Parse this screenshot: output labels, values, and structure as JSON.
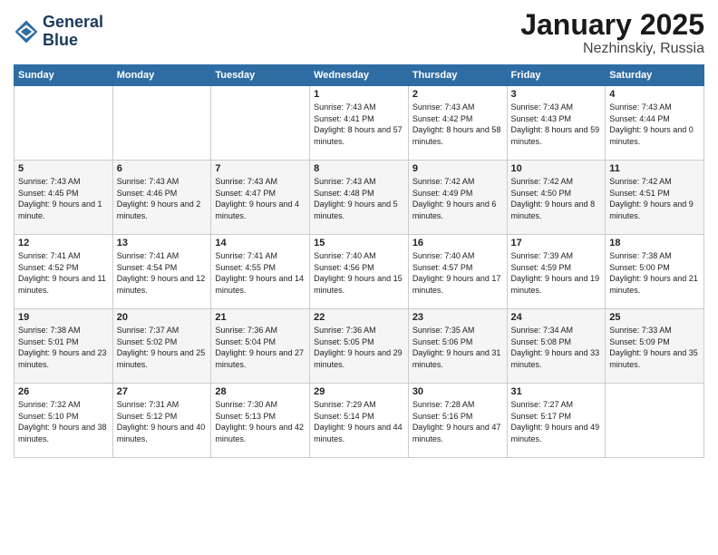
{
  "logo": {
    "line1": "General",
    "line2": "Blue"
  },
  "title": "January 2025",
  "subtitle": "Nezhinskiy, Russia",
  "weekdays": [
    "Sunday",
    "Monday",
    "Tuesday",
    "Wednesday",
    "Thursday",
    "Friday",
    "Saturday"
  ],
  "weeks": [
    [
      {
        "day": "",
        "info": ""
      },
      {
        "day": "",
        "info": ""
      },
      {
        "day": "",
        "info": ""
      },
      {
        "day": "1",
        "info": "Sunrise: 7:43 AM\nSunset: 4:41 PM\nDaylight: 8 hours and 57 minutes."
      },
      {
        "day": "2",
        "info": "Sunrise: 7:43 AM\nSunset: 4:42 PM\nDaylight: 8 hours and 58 minutes."
      },
      {
        "day": "3",
        "info": "Sunrise: 7:43 AM\nSunset: 4:43 PM\nDaylight: 8 hours and 59 minutes."
      },
      {
        "day": "4",
        "info": "Sunrise: 7:43 AM\nSunset: 4:44 PM\nDaylight: 9 hours and 0 minutes."
      }
    ],
    [
      {
        "day": "5",
        "info": "Sunrise: 7:43 AM\nSunset: 4:45 PM\nDaylight: 9 hours and 1 minute."
      },
      {
        "day": "6",
        "info": "Sunrise: 7:43 AM\nSunset: 4:46 PM\nDaylight: 9 hours and 2 minutes."
      },
      {
        "day": "7",
        "info": "Sunrise: 7:43 AM\nSunset: 4:47 PM\nDaylight: 9 hours and 4 minutes."
      },
      {
        "day": "8",
        "info": "Sunrise: 7:43 AM\nSunset: 4:48 PM\nDaylight: 9 hours and 5 minutes."
      },
      {
        "day": "9",
        "info": "Sunrise: 7:42 AM\nSunset: 4:49 PM\nDaylight: 9 hours and 6 minutes."
      },
      {
        "day": "10",
        "info": "Sunrise: 7:42 AM\nSunset: 4:50 PM\nDaylight: 9 hours and 8 minutes."
      },
      {
        "day": "11",
        "info": "Sunrise: 7:42 AM\nSunset: 4:51 PM\nDaylight: 9 hours and 9 minutes."
      }
    ],
    [
      {
        "day": "12",
        "info": "Sunrise: 7:41 AM\nSunset: 4:52 PM\nDaylight: 9 hours and 11 minutes."
      },
      {
        "day": "13",
        "info": "Sunrise: 7:41 AM\nSunset: 4:54 PM\nDaylight: 9 hours and 12 minutes."
      },
      {
        "day": "14",
        "info": "Sunrise: 7:41 AM\nSunset: 4:55 PM\nDaylight: 9 hours and 14 minutes."
      },
      {
        "day": "15",
        "info": "Sunrise: 7:40 AM\nSunset: 4:56 PM\nDaylight: 9 hours and 15 minutes."
      },
      {
        "day": "16",
        "info": "Sunrise: 7:40 AM\nSunset: 4:57 PM\nDaylight: 9 hours and 17 minutes."
      },
      {
        "day": "17",
        "info": "Sunrise: 7:39 AM\nSunset: 4:59 PM\nDaylight: 9 hours and 19 minutes."
      },
      {
        "day": "18",
        "info": "Sunrise: 7:38 AM\nSunset: 5:00 PM\nDaylight: 9 hours and 21 minutes."
      }
    ],
    [
      {
        "day": "19",
        "info": "Sunrise: 7:38 AM\nSunset: 5:01 PM\nDaylight: 9 hours and 23 minutes."
      },
      {
        "day": "20",
        "info": "Sunrise: 7:37 AM\nSunset: 5:02 PM\nDaylight: 9 hours and 25 minutes."
      },
      {
        "day": "21",
        "info": "Sunrise: 7:36 AM\nSunset: 5:04 PM\nDaylight: 9 hours and 27 minutes."
      },
      {
        "day": "22",
        "info": "Sunrise: 7:36 AM\nSunset: 5:05 PM\nDaylight: 9 hours and 29 minutes."
      },
      {
        "day": "23",
        "info": "Sunrise: 7:35 AM\nSunset: 5:06 PM\nDaylight: 9 hours and 31 minutes."
      },
      {
        "day": "24",
        "info": "Sunrise: 7:34 AM\nSunset: 5:08 PM\nDaylight: 9 hours and 33 minutes."
      },
      {
        "day": "25",
        "info": "Sunrise: 7:33 AM\nSunset: 5:09 PM\nDaylight: 9 hours and 35 minutes."
      }
    ],
    [
      {
        "day": "26",
        "info": "Sunrise: 7:32 AM\nSunset: 5:10 PM\nDaylight: 9 hours and 38 minutes."
      },
      {
        "day": "27",
        "info": "Sunrise: 7:31 AM\nSunset: 5:12 PM\nDaylight: 9 hours and 40 minutes."
      },
      {
        "day": "28",
        "info": "Sunrise: 7:30 AM\nSunset: 5:13 PM\nDaylight: 9 hours and 42 minutes."
      },
      {
        "day": "29",
        "info": "Sunrise: 7:29 AM\nSunset: 5:14 PM\nDaylight: 9 hours and 44 minutes."
      },
      {
        "day": "30",
        "info": "Sunrise: 7:28 AM\nSunset: 5:16 PM\nDaylight: 9 hours and 47 minutes."
      },
      {
        "day": "31",
        "info": "Sunrise: 7:27 AM\nSunset: 5:17 PM\nDaylight: 9 hours and 49 minutes."
      },
      {
        "day": "",
        "info": ""
      }
    ]
  ]
}
